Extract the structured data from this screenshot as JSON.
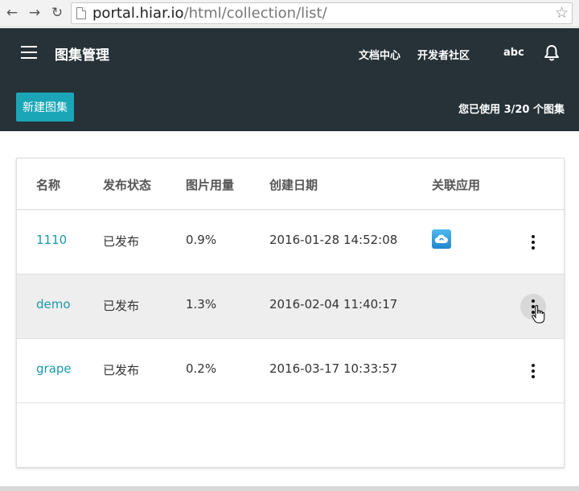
{
  "browser": {
    "url_host": "portal.hiar.io",
    "url_path": "/html/collection/list/"
  },
  "header": {
    "title": "图集管理",
    "links": [
      "文档中心",
      "开发者社区"
    ],
    "user": "abc",
    "new_button": "新建图集",
    "usage": "您已使用 3/20 个图集"
  },
  "table": {
    "columns": [
      "名称",
      "发布状态",
      "图片用量",
      "创建日期",
      "关联应用"
    ],
    "rows": [
      {
        "name": "1110",
        "status": "已发布",
        "usage": "0.9%",
        "date": "2016-01-28 14:52:08",
        "app": "cloud-app-icon"
      },
      {
        "name": "demo",
        "status": "已发布",
        "usage": "1.3%",
        "date": "2016-02-04 11:40:17",
        "app": ""
      },
      {
        "name": "grape",
        "status": "已发布",
        "usage": "0.2%",
        "date": "2016-03-17 10:33:57",
        "app": ""
      }
    ]
  },
  "colors": {
    "header_bg": "#263238",
    "accent": "#1aa6b7",
    "link": "#1a9aaa",
    "hover_row": "#eeeeee"
  }
}
